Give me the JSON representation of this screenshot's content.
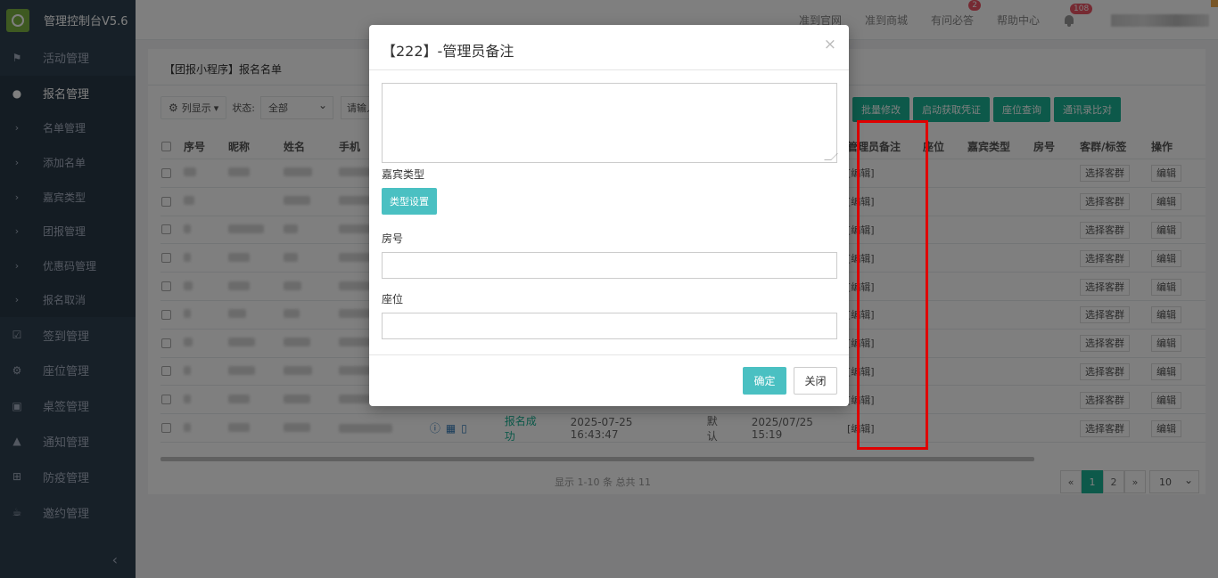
{
  "header": {
    "app_title": "管理控制台V5.6",
    "nav": [
      {
        "label": "准到官网"
      },
      {
        "label": "准到商城"
      },
      {
        "label": "有问必答",
        "badge": "2"
      },
      {
        "label": "帮助中心"
      }
    ],
    "notification_count": "108"
  },
  "sidebar": {
    "items": [
      {
        "label": "活动管理",
        "icon": "flag-icon",
        "glyph": "⚑"
      },
      {
        "label": "报名管理",
        "icon": "user-icon",
        "glyph": "●"
      }
    ],
    "sub_items": [
      {
        "label": "名单管理"
      },
      {
        "label": "添加名单"
      },
      {
        "label": "嘉宾类型"
      },
      {
        "label": "团报管理"
      },
      {
        "label": "优惠码管理"
      },
      {
        "label": "报名取消"
      }
    ],
    "bottom_items": [
      {
        "label": "签到管理",
        "icon": "check-square-icon",
        "glyph": "☑"
      },
      {
        "label": "座位管理",
        "icon": "cogs-icon",
        "glyph": "⚙"
      },
      {
        "label": "桌签管理",
        "icon": "calendar-icon",
        "glyph": "▣"
      },
      {
        "label": "通知管理",
        "icon": "bell-icon",
        "glyph": "▲"
      },
      {
        "label": "防疫管理",
        "icon": "plus-square-icon",
        "glyph": "⊞"
      },
      {
        "label": "邀约管理",
        "icon": "coffee-icon",
        "glyph": "☕"
      }
    ],
    "collapse_glyph": "‹"
  },
  "page": {
    "title": "【团报小程序】报名名单",
    "toolbar": {
      "columns_button": "列显示",
      "status_label": "状态:",
      "status_value": "全部",
      "search_placeholder": "请输入",
      "buttons": [
        "批量修改",
        "启动获取凭证",
        "座位查询",
        "通讯录比对"
      ]
    },
    "table": {
      "columns": [
        "序号",
        "昵称",
        "姓名",
        "手机",
        "管理员备注",
        "座位",
        "嘉宾类型",
        "房号",
        "客群/标签",
        "操作"
      ],
      "rows": [
        {
          "remark": "[编辑]",
          "group": "选择客群",
          "action": "编辑"
        },
        {
          "remark": "[编辑]",
          "group": "选择客群",
          "action": "编辑"
        },
        {
          "remark": "[编辑]",
          "group": "选择客群",
          "action": "编辑"
        },
        {
          "remark": "[编辑]",
          "group": "选择客群",
          "action": "编辑"
        },
        {
          "remark": "[编辑]",
          "group": "选择客群",
          "action": "编辑"
        },
        {
          "remark": "[编辑]",
          "group": "选择客群",
          "action": "编辑"
        },
        {
          "remark": "[编辑]",
          "group": "选择客群",
          "action": "编辑"
        },
        {
          "remark": "[编辑]",
          "group": "选择客群",
          "action": "编辑"
        },
        {
          "remark": "[编辑]",
          "group": "选择客群",
          "action": "编辑"
        },
        {
          "remark": "[编辑]",
          "group": "选择客群",
          "action": "编辑",
          "status": "报名成功",
          "reg_time": "2025-07-25 16:43:47",
          "default": "默认",
          "date2": "2025/07/25 15:19"
        }
      ]
    },
    "footer_text": "显示 1-10 条 总共 11",
    "pagination": {
      "prev": "«",
      "pages": [
        "1",
        "2"
      ],
      "next": "»",
      "page_size": "10"
    }
  },
  "modal": {
    "title": "【222】-管理员备注",
    "close_glyph": "×",
    "guest_type_label": "嘉宾类型",
    "type_button": "类型设置",
    "room_label": "房号",
    "seat_label": "座位",
    "ok_button": "确定",
    "close_button": "关闭"
  }
}
